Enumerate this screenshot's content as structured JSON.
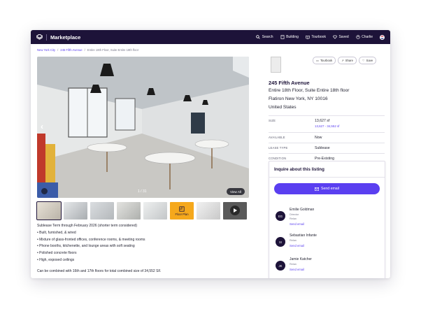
{
  "nav": {
    "brand": "Marketplace",
    "items": [
      {
        "label": "Search",
        "icon": "search-icon"
      },
      {
        "label": "Building",
        "icon": "building-icon"
      },
      {
        "label": "Tourbook",
        "icon": "book-icon"
      },
      {
        "label": "Saved",
        "icon": "heart-icon"
      },
      {
        "label": "Charlie",
        "icon": "user-icon"
      }
    ]
  },
  "breadcrumb": [
    "New York City",
    "245 Fifth Avenue",
    "Entire 18th Floor, Suite Entire 18th floor"
  ],
  "gallery": {
    "counter": "1 / 31",
    "view_all": "View All",
    "floor_plan_label": "Floor Plan"
  },
  "description": {
    "intro": "Sublease Term through February 2026 (shorter term considered)",
    "bullets": [
      "• Built, furnished, & wired",
      "• Mixture of glass-fronted offices, conference rooms, & meeting rooms",
      "• Phone booths, kitchenette, and lounge areas with soft seating",
      "• Polished concrete floors",
      "• High, exposed ceilings"
    ],
    "footer": "Can be combined with 16th and 17th floors for total combined size of 34,552 SF."
  },
  "listing": {
    "actions": [
      "Tourbook",
      "Share",
      "Save"
    ],
    "title": "245 Fifth Avenue",
    "suite": "Entire 18th Floor, Suite Entire 18th floor",
    "location": "Flatiron   New York, NY 10016",
    "country": "United States",
    "facts": [
      {
        "label": "SIZE",
        "value": "13,627 sf",
        "extra": "13,627 - 34,552 sf"
      },
      {
        "label": "AVAILABLE",
        "value": "Now"
      },
      {
        "label": "LEASE TYPE",
        "value": "Sublease"
      },
      {
        "label": "CONDITION",
        "value": "Pre-Existing"
      }
    ]
  },
  "inquire": {
    "title": "Inquire about this listing",
    "send_label": "Send email",
    "contacts": [
      {
        "initials": "EG",
        "name": "Emilie Goldman",
        "role": "Director",
        "company": "Relan",
        "link": "Send email"
      },
      {
        "initials": "SI",
        "name": "Sebastian Infante",
        "role": "",
        "company": "Relan",
        "link": "Send email"
      },
      {
        "initials": "JK",
        "name": "Jamie Katcher",
        "role": "",
        "company": "Relan",
        "link": "Send email"
      }
    ]
  },
  "colors": {
    "nav_bg": "#1d1339",
    "accent": "#5a3ff0",
    "floor_plan": "#f5a81c"
  }
}
